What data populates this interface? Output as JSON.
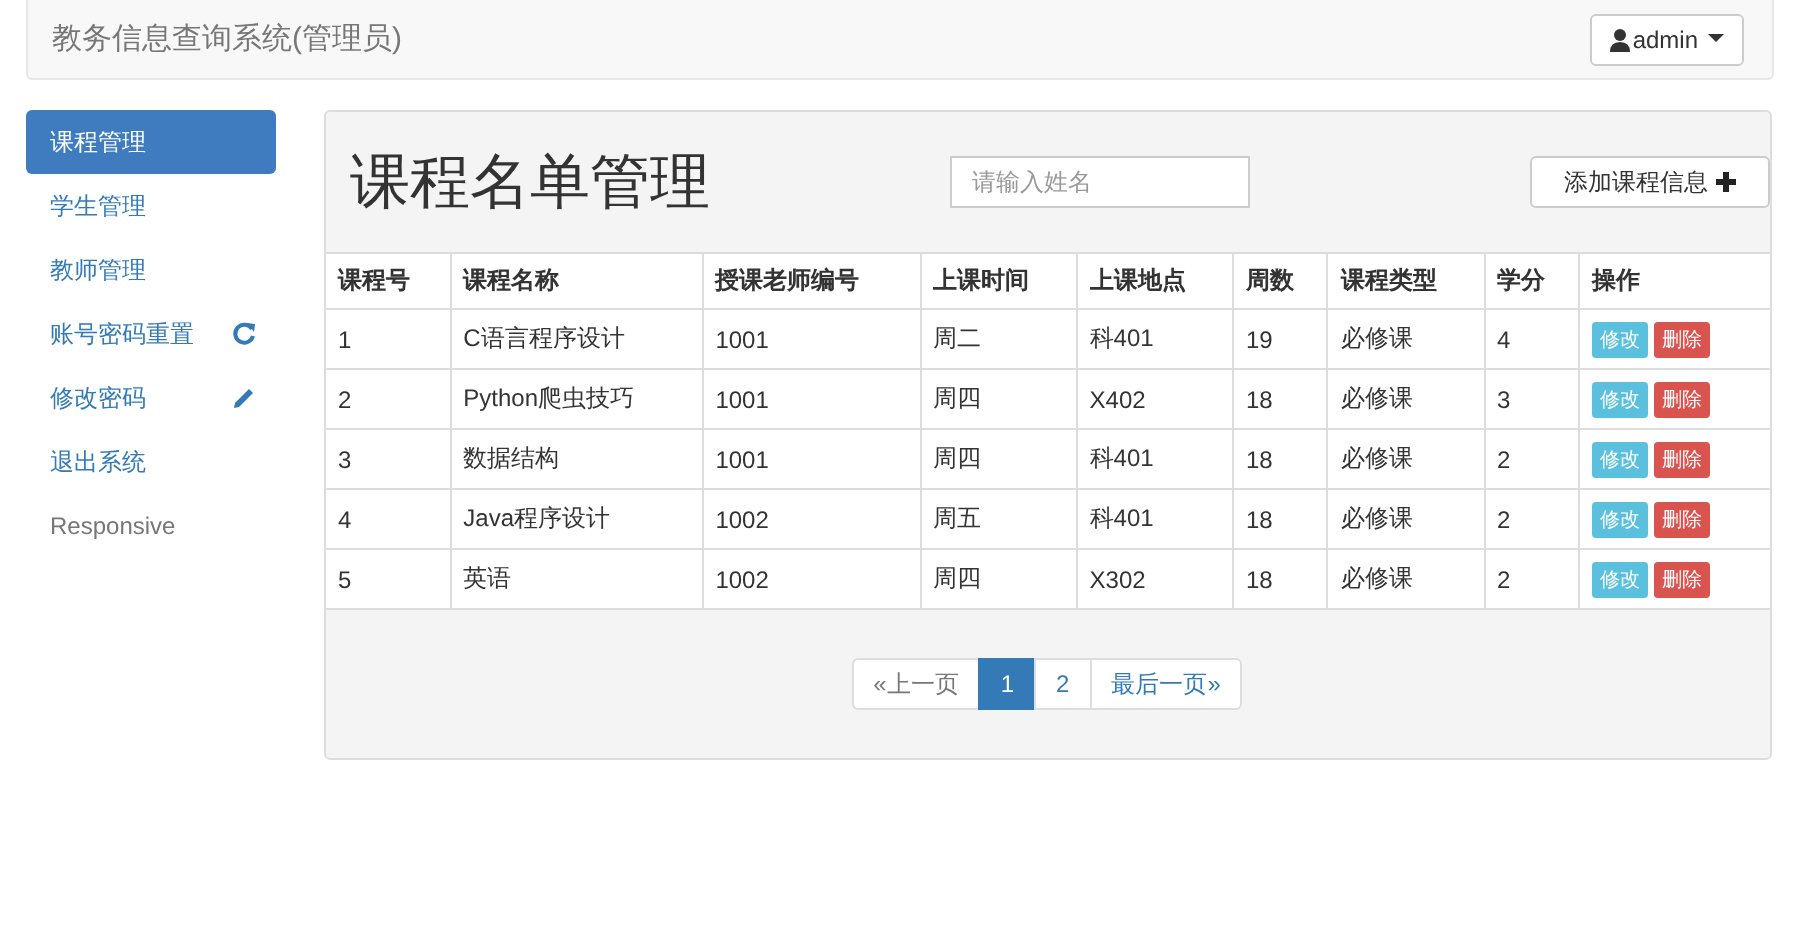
{
  "navbar": {
    "title": "教务信息查询系统(管理员)",
    "user_menu": "admin"
  },
  "sidebar": {
    "items": [
      {
        "label": "课程管理",
        "kind": "link",
        "selected": true
      },
      {
        "label": "学生管理",
        "kind": "link",
        "selected": false
      },
      {
        "label": "教师管理",
        "kind": "link",
        "selected": false
      },
      {
        "label": "账号密码重置",
        "kind": "link-refresh",
        "selected": false
      },
      {
        "label": "修改密码",
        "kind": "link-pencil",
        "selected": false
      },
      {
        "label": "退出系统",
        "kind": "link",
        "selected": false
      },
      {
        "label": "Responsive",
        "kind": "text",
        "selected": false
      }
    ]
  },
  "panel": {
    "title": "课程名单管理",
    "search": {
      "placeholder": "请输入姓名"
    },
    "add_button": "添加课程信息",
    "table": {
      "columns": [
        "课程号",
        "课程名称",
        "授课老师编号",
        "上课时间",
        "上课地点",
        "周数",
        "课程类型",
        "学分",
        "操作"
      ],
      "rows": [
        {
          "cells": [
            "1",
            "C语言程序设计",
            "1001",
            "周二",
            "科401",
            "19",
            "必修课",
            "4"
          ],
          "actions": [
            "修改",
            "删除"
          ]
        },
        {
          "cells": [
            "2",
            "Python爬虫技巧",
            "1001",
            "周四",
            "X402",
            "18",
            "必修课",
            "3"
          ],
          "actions": [
            "修改",
            "删除"
          ]
        },
        {
          "cells": [
            "3",
            "数据结构",
            "1001",
            "周四",
            "科401",
            "18",
            "必修课",
            "2"
          ],
          "actions": [
            "修改",
            "删除"
          ]
        },
        {
          "cells": [
            "4",
            "Java程序设计",
            "1002",
            "周五",
            "科401",
            "18",
            "必修课",
            "2"
          ],
          "actions": [
            "修改",
            "删除"
          ]
        },
        {
          "cells": [
            "5",
            "英语",
            "1002",
            "周四",
            "X302",
            "18",
            "必修课",
            "2"
          ],
          "actions": [
            "修改",
            "删除"
          ]
        }
      ]
    },
    "pagination": [
      {
        "label": "«上一页",
        "selected": false,
        "disabled": true
      },
      {
        "label": "1",
        "selected": true,
        "disabled": false
      },
      {
        "label": "2",
        "selected": false,
        "disabled": false
      },
      {
        "label": "最后一页»",
        "selected": false,
        "disabled": false
      }
    ]
  }
}
